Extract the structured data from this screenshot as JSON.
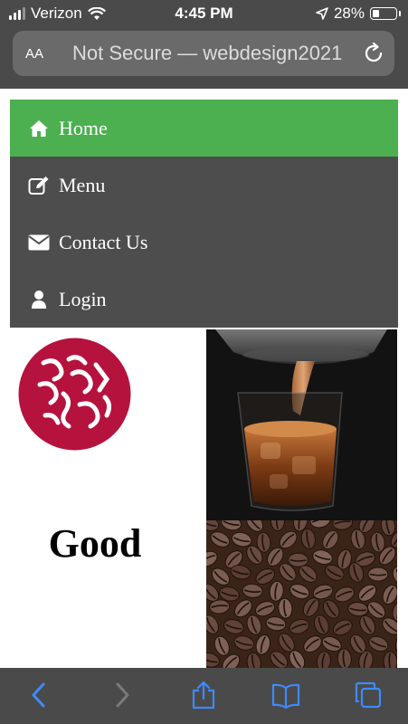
{
  "status": {
    "carrier": "Verizon",
    "time": "4:45 PM",
    "battery": "28%",
    "battery_level": 0.28
  },
  "browser": {
    "text_size_label": "AA",
    "url": "Not Secure — webdesign2021",
    "reload_icon": "reload-icon"
  },
  "nav": {
    "items": [
      {
        "label": "Home",
        "icon": "home-icon",
        "active": true
      },
      {
        "label": "Menu",
        "icon": "edit-icon",
        "active": false
      },
      {
        "label": "Contact Us",
        "icon": "envelope-icon",
        "active": false
      },
      {
        "label": "Login",
        "icon": "user-icon",
        "active": false
      }
    ]
  },
  "content": {
    "heading": "Good"
  },
  "toolbar": {
    "back_icon": "back-icon",
    "forward_icon": "forward-icon",
    "share_icon": "share-icon",
    "bookmarks_icon": "bookmarks-icon",
    "tabs_icon": "tabs-icon"
  },
  "colors": {
    "accent": "#4caf50",
    "nav_bg": "#4d4d4d",
    "browser_chrome": "#4a4a4a",
    "toolbar_icon": "#3d8bff",
    "logo_red": "#b5123e"
  }
}
